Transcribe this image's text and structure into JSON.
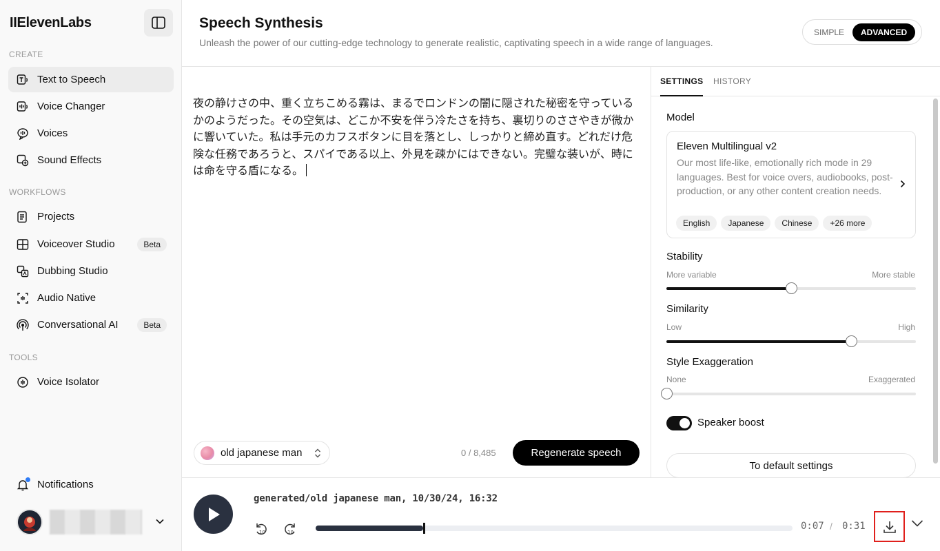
{
  "app": {
    "logo": "IIElevenLabs"
  },
  "sidebar": {
    "sections": {
      "create": "CREATE",
      "workflows": "WORKFLOWS",
      "tools": "TOOLS"
    },
    "items": [
      {
        "label": "Text to Speech",
        "icon": "text-to-speech-icon"
      },
      {
        "label": "Voice Changer",
        "icon": "voice-changer-icon"
      },
      {
        "label": "Voices",
        "icon": "voices-icon"
      },
      {
        "label": "Sound Effects",
        "icon": "sound-effects-icon"
      },
      {
        "label": "Projects",
        "icon": "projects-icon"
      },
      {
        "label": "Voiceover Studio",
        "icon": "voiceover-studio-icon",
        "badge": "Beta"
      },
      {
        "label": "Dubbing Studio",
        "icon": "dubbing-studio-icon"
      },
      {
        "label": "Audio Native",
        "icon": "audio-native-icon"
      },
      {
        "label": "Conversational AI",
        "icon": "conversational-ai-icon",
        "badge": "Beta"
      },
      {
        "label": "Voice Isolator",
        "icon": "voice-isolator-icon"
      }
    ],
    "notifications": "Notifications"
  },
  "header": {
    "title": "Speech Synthesis",
    "subtitle": "Unleash the power of our cutting-edge technology to generate realistic, captivating speech in a wide range of languages.",
    "mode_simple": "SIMPLE",
    "mode_advanced": "ADVANCED"
  },
  "editor": {
    "text": "夜の静けさの中、重く立ちこめる霧は、まるでロンドンの闇に隠された秘密を守っているかのようだった。その空気は、どこか不安を伴う冷たさを持ち、裏切りのささやきが微かに響いていた。私は手元のカフスボタンに目を落とし、しっかりと締め直す。どれだけ危険な任務であろうと、スパイである以上、外見を疎かにはできない。完璧な装いが、時には命を守る盾になる。",
    "voice": "old japanese man",
    "char_count": "0 / 8,485",
    "regenerate_label": "Regenerate speech"
  },
  "settings": {
    "tab_settings": "SETTINGS",
    "tab_history": "HISTORY",
    "model_label": "Model",
    "model_name": "Eleven Multilingual v2",
    "model_desc": "Our most life-like, emotionally rich mode in 29 languages. Best for voice overs, audiobooks, post-production, or any other content creation needs.",
    "languages": [
      "English",
      "Japanese",
      "Chinese",
      "+26 more"
    ],
    "stability": {
      "label": "Stability",
      "min": "More variable",
      "max": "More stable",
      "value": 0.5
    },
    "similarity": {
      "label": "Similarity",
      "min": "Low",
      "max": "High",
      "value": 0.74
    },
    "style": {
      "label": "Style Exaggeration",
      "min": "None",
      "max": "Exaggerated",
      "value": 0.0
    },
    "speaker_boost": {
      "label": "Speaker boost",
      "on": true
    },
    "default_label": "To default settings"
  },
  "player": {
    "title": "generated/old japanese man, 10/30/24, 16:32",
    "current": "0:07",
    "separator": "/",
    "duration": "0:31",
    "progress": 0.226
  }
}
